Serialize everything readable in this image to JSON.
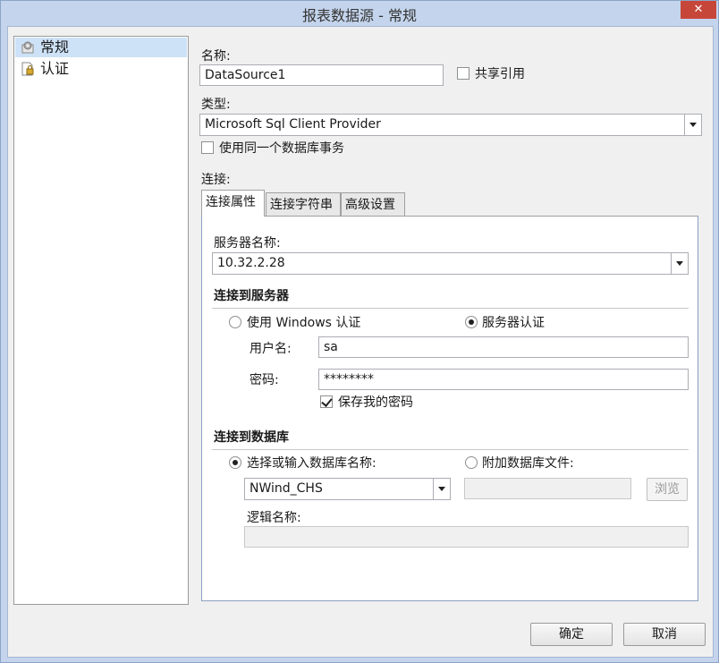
{
  "window": {
    "title": "报表数据源 - 常规",
    "close_label": "✕"
  },
  "nav": {
    "items": [
      {
        "label": "常规",
        "icon": "gear-document-icon",
        "selected": true
      },
      {
        "label": "认证",
        "icon": "lock-document-icon",
        "selected": false
      }
    ]
  },
  "general": {
    "name_label": "名称:",
    "name_value": "DataSource1",
    "shared_ref_label": "共享引用",
    "type_label": "类型:",
    "type_value": "Microsoft Sql Client Provider",
    "same_transaction_label": "使用同一个数据库事务",
    "connection_label": "连接:"
  },
  "tabs": [
    {
      "label": "连接属性",
      "active": true
    },
    {
      "label": "连接字符串",
      "active": false
    },
    {
      "label": "高级设置",
      "active": false
    }
  ],
  "connection": {
    "server_name_label": "服务器名称:",
    "server_name_value": "10.32.2.28",
    "connect_server_title": "连接到服务器",
    "windows_auth_label": "使用 Windows 认证",
    "server_auth_label": "服务器认证",
    "username_label": "用户名:",
    "username_value": "sa",
    "password_label": "密码:",
    "password_value": "********",
    "save_password_label": "保存我的密码",
    "connect_db_title": "连接到数据库",
    "select_db_label": "选择或输入数据库名称:",
    "attach_db_label": "附加数据库文件:",
    "db_name_value": "NWind_CHS",
    "browse_label": "浏览",
    "logical_name_label": "逻辑名称:"
  },
  "footer": {
    "ok_label": "确定",
    "cancel_label": "取消"
  }
}
